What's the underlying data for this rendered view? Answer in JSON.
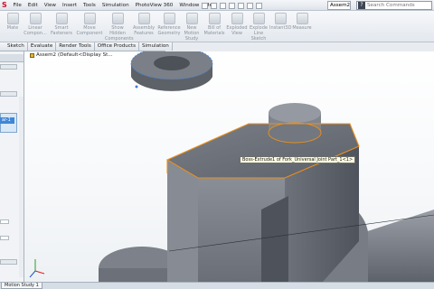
{
  "menubar": {
    "items": [
      "File",
      "Edit",
      "View",
      "Insert",
      "Tools",
      "Simulation",
      "PhotoView 360",
      "Window",
      "Help"
    ],
    "document_title": "Assem2",
    "search": {
      "placeholder": "Search Commands"
    }
  },
  "ribbon": {
    "buttons": [
      {
        "label": "Mate",
        "icon": "mate-icon"
      },
      {
        "label": "Linear\nCompon...",
        "icon": "linear-pattern-icon"
      },
      {
        "label": "Smart\nFasteners",
        "icon": "smart-fasteners-icon"
      },
      {
        "label": "Move\nComponent",
        "icon": "move-component-icon"
      },
      {
        "label": "Show\nHidden\nComponents",
        "icon": "show-hidden-icon"
      },
      {
        "label": "Assembly\nFeatures",
        "icon": "assembly-features-icon"
      },
      {
        "label": "Reference\nGeometry",
        "icon": "reference-geometry-icon"
      },
      {
        "label": "New\nMotion\nStudy",
        "icon": "new-motion-study-icon"
      },
      {
        "label": "Bill of\nMaterials",
        "icon": "bill-of-materials-icon"
      },
      {
        "label": "Exploded\nView",
        "icon": "exploded-view-icon"
      },
      {
        "label": "Explode\nLine\nSketch",
        "icon": "explode-line-sketch-icon"
      },
      {
        "label": "Instant3D",
        "icon": "instant3d-icon"
      },
      {
        "label": "Measure",
        "icon": "measure-icon"
      }
    ]
  },
  "tabs": [
    "Sketch",
    "Evaluate",
    "Render Tools",
    "Office Products",
    "Simulation"
  ],
  "left_panel": {
    "selected_item": "ar-1"
  },
  "viewport": {
    "tree_item": "Assem2  (Default<Display St...",
    "tooltip": "Boss-Extrude1 of Fork_Universal Joint Part_1<1>"
  },
  "bottom": {
    "tab": "Motion Study 1"
  },
  "colors": {
    "accent_selection": "#e8901f",
    "part_gray": "#6c7078",
    "viewport_bg": "#ffffff"
  }
}
